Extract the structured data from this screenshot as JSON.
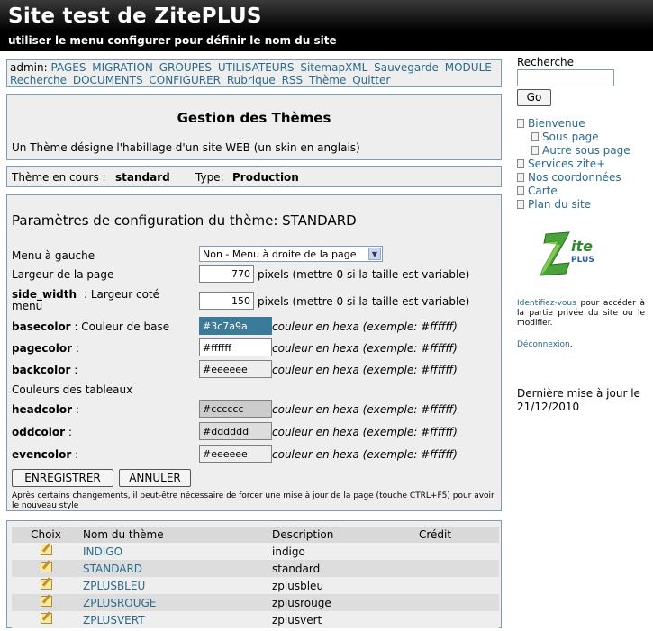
{
  "header": {
    "title": "Site test de ZitePLUS",
    "subtitle": "utiliser le menu configurer pour définir le nom du site"
  },
  "menu": {
    "prefix": "admin:",
    "items": [
      "PAGES",
      "MIGRATION",
      "GROUPES",
      "UTILISATEURS",
      "SitemapXML",
      "Sauvegarde",
      "MODULE",
      "Recherche",
      "DOCUMENTS",
      "CONFIGURER",
      "Rubrique",
      "RSS",
      "Thème",
      "Quitter"
    ]
  },
  "gestion": {
    "title": "Gestion des Thèmes",
    "description": "Un Thème désigne l'habillage d'un site WEB (un skin en anglais)"
  },
  "current": {
    "theme_label": "Thème en cours :",
    "theme_value": "standard",
    "type_label": "Type:",
    "type_value": "Production"
  },
  "config": {
    "title": "Paramètres de configuration du thème: STANDARD",
    "menu_label": "Menu à gauche",
    "menu_value": "Non - Menu à droite de la page",
    "width_label": "Largeur de la page",
    "width_value": "770",
    "width_hint": "pixels (mettre 0 si la taille est variable)",
    "side_key": "side_width",
    "side_label_1": ":   Largeur   coté",
    "side_label_2": "menu",
    "side_value": "150",
    "side_hint": "pixels (mettre 0 si la taille est variable)",
    "colors": [
      {
        "key": "basecolor",
        "label": " : Couleur de base",
        "value": "#3c7a9a"
      },
      {
        "key": "pagecolor",
        "label": " :",
        "value": "#ffffff"
      },
      {
        "key": "backcolor",
        "label": " :",
        "value": "#eeeeee"
      }
    ],
    "table_colors_label": "Couleurs des tableaux",
    "table_colors": [
      {
        "key": "headcolor",
        "label": " :",
        "value": "#cccccc"
      },
      {
        "key": "oddcolor",
        "label": " :",
        "value": "#dddddd"
      },
      {
        "key": "evencolor",
        "label": " :",
        "value": "#eeeeee"
      }
    ],
    "hint": "couleur en hexa (exemple: #ffffff)",
    "save_label": "ENREGISTRER",
    "cancel_label": "ANNULER",
    "note": "Après certains changements, il peut-être nécessaire de forcer une mise à jour de la page (touche CTRL+F5) pour avoir le nouveau style"
  },
  "themes_table": {
    "headers": [
      "Choix",
      "Nom du thème",
      "Description",
      "Crédit"
    ],
    "rows": [
      {
        "name": "INDIGO",
        "description": "indigo"
      },
      {
        "name": "STANDARD",
        "description": "standard"
      },
      {
        "name": "ZPLUSBLEU",
        "description": "zplusbleu"
      },
      {
        "name": "ZPLUSROUGE",
        "description": "zplusrouge"
      },
      {
        "name": "ZPLUSVERT",
        "description": "zplusvert"
      }
    ]
  },
  "sidebar": {
    "search_label": "Recherche",
    "go_label": "Go",
    "nav": [
      "Bienvenue",
      "Sous page",
      "Autre sous page",
      "Services zite+",
      "Nos coordonnées",
      "Carte",
      "Plan du site"
    ],
    "logo_text_1": "ite",
    "logo_text_2": "PLUS",
    "login_link": "Identifiez-vous",
    "login_text": "pour accéder à la partie privée du site ou le modifier.",
    "logout_link": "Déconnexion",
    "update_label": "Dernière mise à jour le 21/12/2010"
  }
}
